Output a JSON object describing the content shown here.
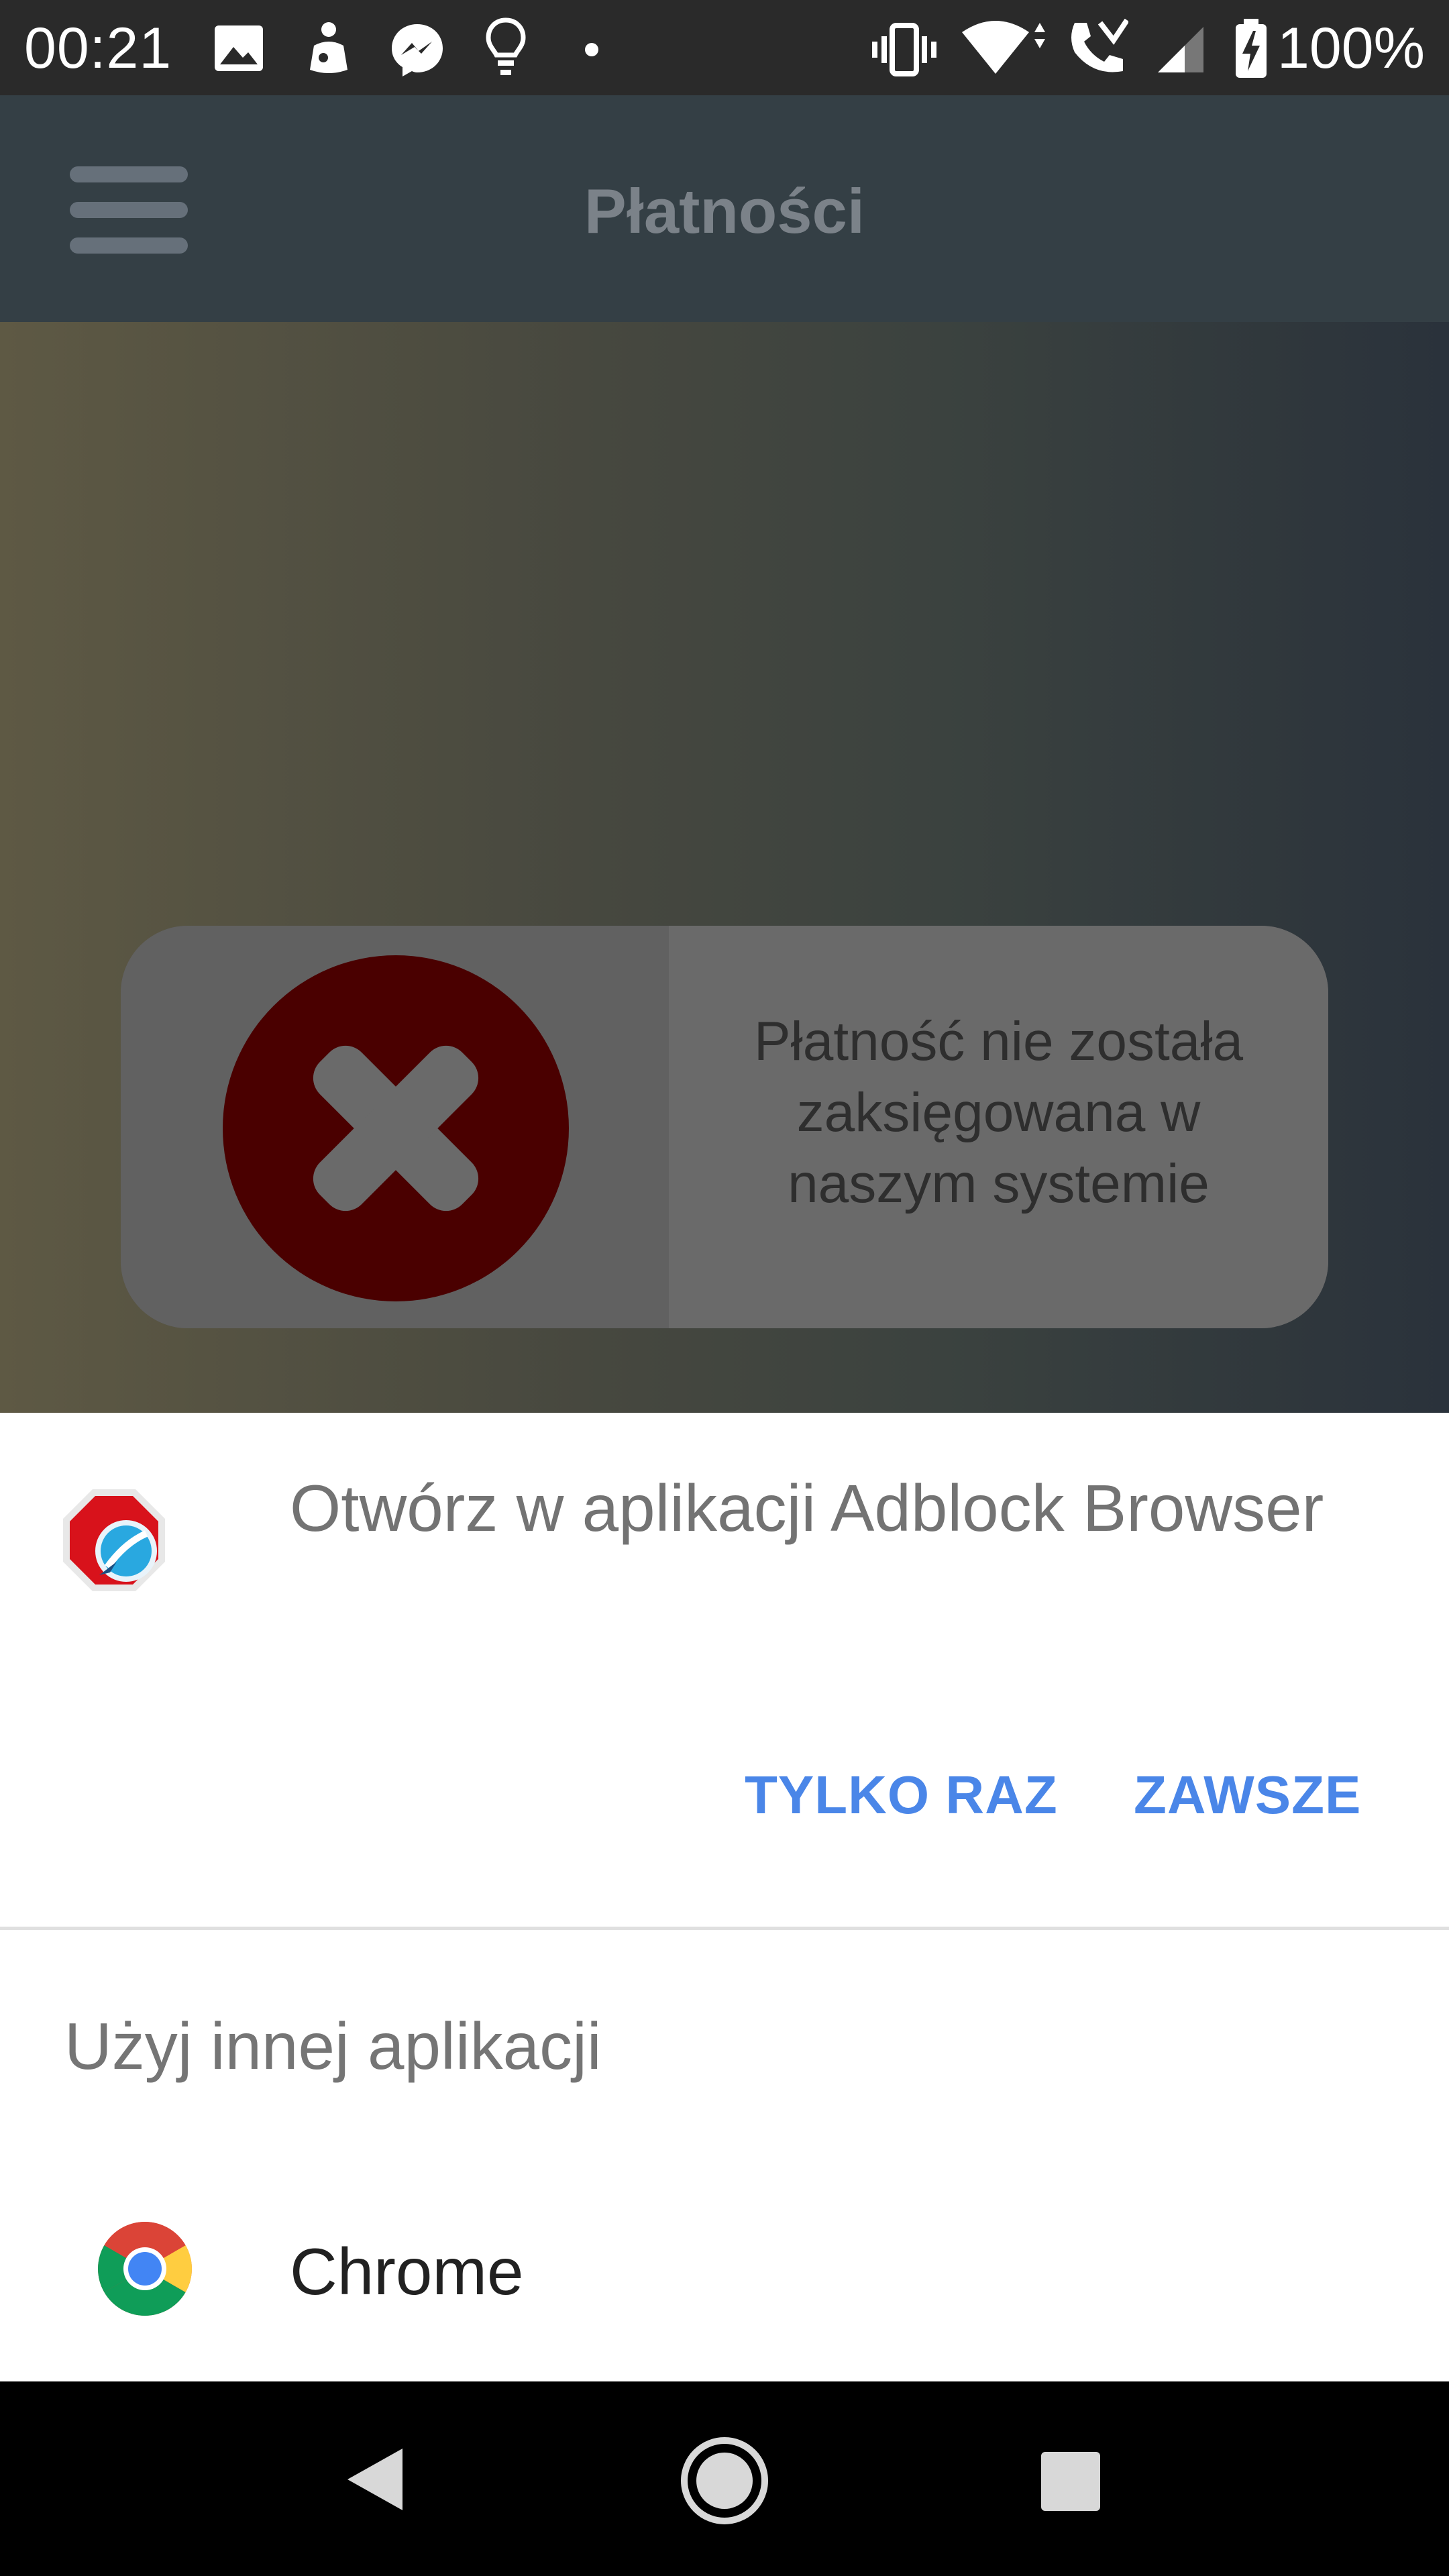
{
  "status_bar": {
    "time": "00:21",
    "battery": "100%",
    "icons": [
      "image-icon",
      "hand-pointing-icon",
      "messenger-icon",
      "lightbulb-icon",
      "dot-icon",
      "vibrate-icon",
      "wifi-icon",
      "phone-call-icon",
      "signal-icon",
      "battery-charging-icon"
    ]
  },
  "toolbar": {
    "menu_icon": "hamburger-menu-icon",
    "title": "Płatności"
  },
  "payment_result": {
    "icon": "error-x-icon",
    "message": "Płatność nie została zaksięgowana w naszym systemie",
    "icon_color": "#4a0000"
  },
  "chooser": {
    "open_in_title": "Otwórz w aplikacji Adblock Browser",
    "open_in_app_icon": "adblock-browser-icon",
    "just_once_label": "TYLKO RAZ",
    "always_label": "ZAWSZE",
    "use_other_app_label": "Użyj innej aplikacji",
    "apps": [
      {
        "name": "Chrome",
        "icon": "chrome-icon"
      }
    ],
    "accent_color": "#4a86e8"
  },
  "nav_bar": {
    "buttons": [
      "back-icon",
      "home-icon",
      "recents-icon"
    ]
  }
}
